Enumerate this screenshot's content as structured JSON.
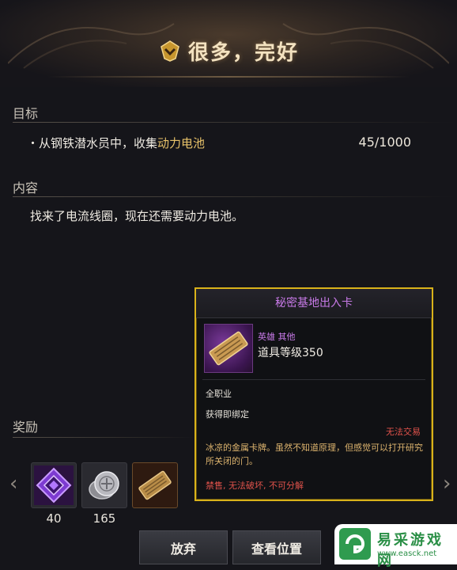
{
  "header": {
    "title": "很多，完好"
  },
  "objective": {
    "label": "目标",
    "bullet": "・",
    "text_prefix": "从钢铁潜水员中，收集",
    "text_highlight": "动力电池",
    "count": "45/1000"
  },
  "content": {
    "label": "内容",
    "text": "找来了电流线圈，现在还需要动力电池。"
  },
  "rewards": {
    "label": "奖励",
    "items": [
      {
        "icon": "purple-crystal-icon",
        "count": "40"
      },
      {
        "icon": "silver-coin-icon",
        "count": "165"
      },
      {
        "icon": "keycard-icon",
        "count": ""
      }
    ]
  },
  "buttons": {
    "abandon": "放弃",
    "view_location": "查看位置"
  },
  "tooltip": {
    "title": "秘密基地出入卡",
    "rarity": "英雄 其他",
    "item_level": "道具等级350",
    "class": "全职业",
    "bind": "获得即绑定",
    "trade": "无法交易",
    "description": "冰凉的金属卡牌。虽然不知道原理，但感觉可以打开研究所关闭的门。",
    "flags": [
      {
        "text": "禁售",
        "color": "#e0524b"
      },
      {
        "text": "无法破坏",
        "color": "#e0524b"
      },
      {
        "text": "不可分解",
        "color": "#e0524b"
      }
    ],
    "border_color": "#d9b21a"
  },
  "watermark": {
    "name": "易采游戏网",
    "url": "www.easck.net"
  }
}
